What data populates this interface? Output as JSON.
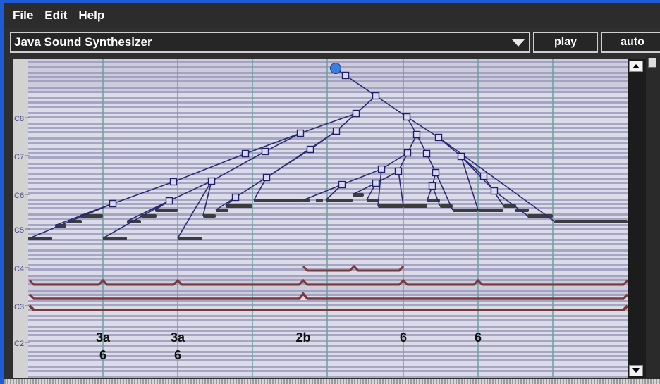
{
  "menu": {
    "items": [
      "File",
      "Edit",
      "Help"
    ]
  },
  "toolbar": {
    "synth_selected": "Java Sound Synthesizer",
    "play_label": "play",
    "auto_label": "auto"
  },
  "piano_roll": {
    "octave_labels": [
      "C8",
      "C7",
      "C6",
      "C5",
      "C4",
      "C3",
      "C2"
    ],
    "annotations": [
      {
        "top": "3a",
        "bottom": "6"
      },
      {
        "top": "3a",
        "bottom": "6"
      },
      {
        "top": "2b",
        "bottom": ""
      },
      {
        "top": "6",
        "bottom": ""
      },
      {
        "top": "6",
        "bottom": ""
      }
    ]
  },
  "colors": {
    "tree_line": "#2a2a70",
    "node_box": "#1e1e6a",
    "note_bar": "#3c3c3c",
    "chord_line": "#7a3a3a",
    "grid_line": "#6aa0a0",
    "root_node": "#3a7ee0"
  },
  "icons": {
    "dropdown": "chevron-down-icon",
    "scroll_up": "arrow-up-icon",
    "scroll_down": "arrow-down-icon"
  }
}
